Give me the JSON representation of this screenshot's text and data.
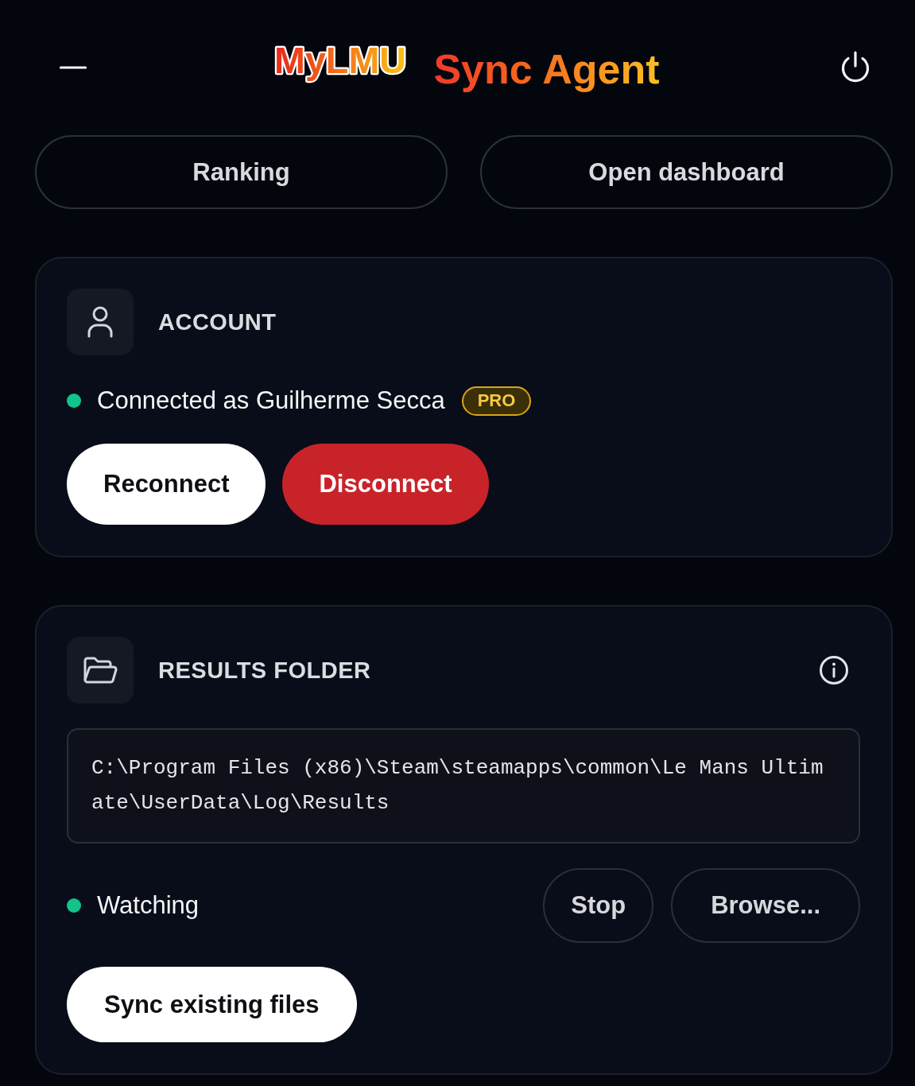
{
  "header": {
    "logo": "MyLMU",
    "title": "Sync Agent"
  },
  "nav_buttons": [
    {
      "label": "Ranking"
    },
    {
      "label": "Open dashboard"
    }
  ],
  "account": {
    "title": "ACCOUNT",
    "status": {
      "text": "Connected as Guilherme Secca",
      "connected": true
    },
    "badge": "PRO",
    "buttons": [
      {
        "label": "Reconnect",
        "kind": "primary"
      },
      {
        "label": "Disconnect",
        "kind": "danger"
      }
    ]
  },
  "results_folder": {
    "title": "RESULTS FOLDER",
    "path": "C:\\Program Files (x86)\\Steam\\steamapps\\common\\Le Mans Ultimate\\UserData\\Log\\Results",
    "status": {
      "text": "Watching",
      "active": true
    },
    "actions": [
      {
        "label": "Stop",
        "kind": "outline"
      },
      {
        "label": "Browse...",
        "kind": "outline"
      }
    ],
    "sync_button": {
      "label": "Sync existing files",
      "kind": "primary"
    }
  }
}
